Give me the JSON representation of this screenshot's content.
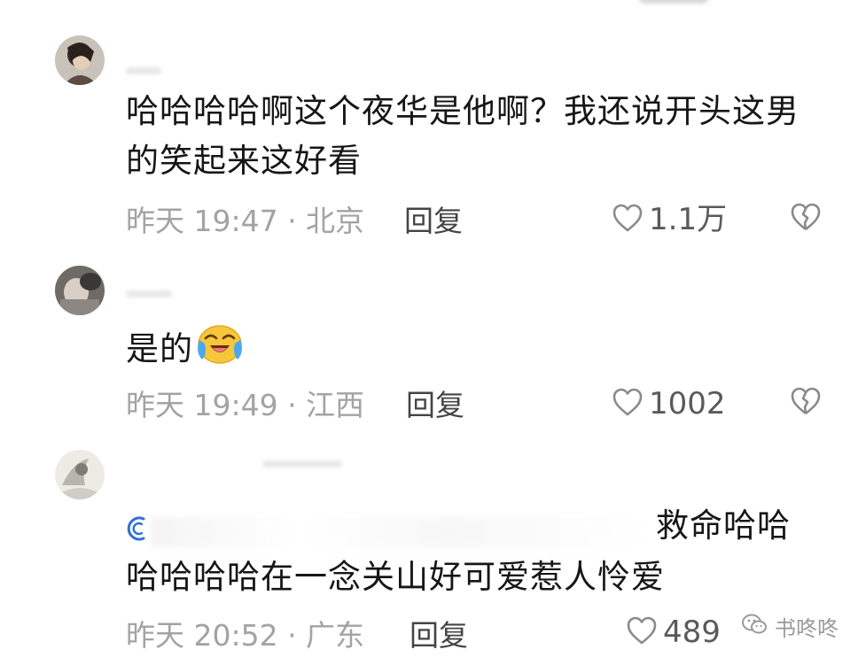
{
  "comments": [
    {
      "text": "哈哈哈哈啊这个夜华是他啊？我还说开头这男的笑起来这好看",
      "time_location": "昨天 19:47 · 北京",
      "reply_label": "回复",
      "likes": "1.1万"
    },
    {
      "text": "是的",
      "emoji": "crying-laughing-emoji",
      "time_location": "昨天 19:49 · 江西",
      "reply_label": "回复",
      "likes": "1002"
    },
    {
      "quote_tail": "救命哈哈",
      "text": "哈哈哈哈在一念关山好可爱惹人怜爱",
      "time_location": "昨天 20:52 · 广东",
      "reply_label": "回复",
      "likes": "489"
    }
  ],
  "watermark": {
    "label": "书咚咚",
    "icon": "wechat-icon"
  },
  "colors": {
    "text": "#161616",
    "meta": "#a3a3a3",
    "icon": "#9a9a9a",
    "link": "#2f6fd6"
  }
}
